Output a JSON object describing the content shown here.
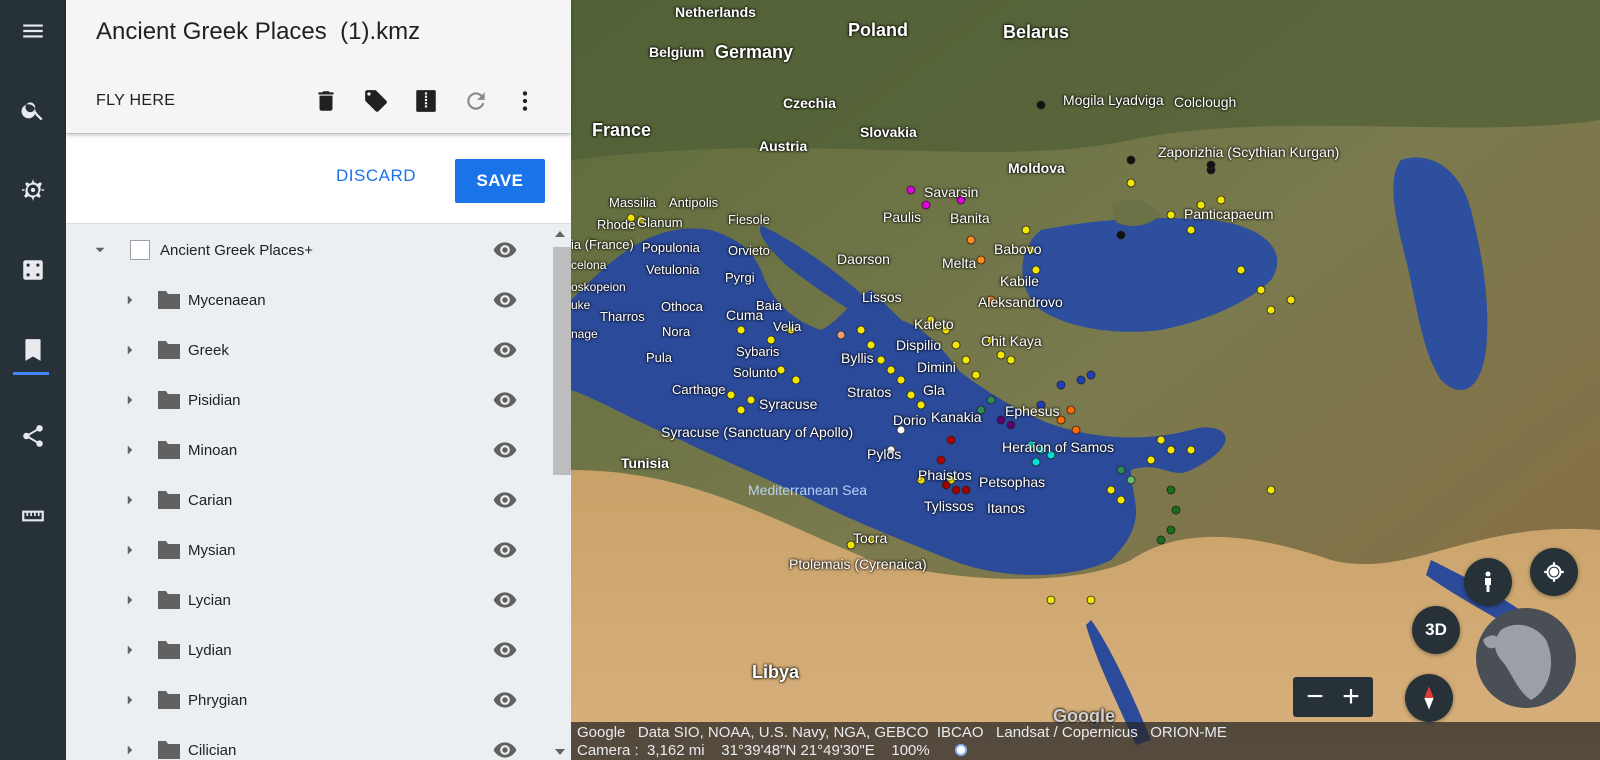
{
  "panel": {
    "title": "Ancient Greek Places  (1).kmz",
    "fly_here": "FLY HERE",
    "discard": "DISCARD",
    "save": "SAVE",
    "root_label": "Ancient Greek Places+",
    "folders": [
      "Mycenaean",
      "Greek",
      "Pisidian",
      "Minoan",
      "Carian",
      "Mysian",
      "Lycian",
      "Lydian",
      "Phrygian",
      "Cilician"
    ]
  },
  "map": {
    "places": {
      "netherlands": "Netherlands",
      "belgium": "Belgium",
      "germany": "Germany",
      "poland": "Poland",
      "belarus": "Belarus",
      "czechia": "Czechia",
      "france": "France",
      "austria": "Austria",
      "slovakia": "Slovakia",
      "moldova": "Moldova",
      "mogila": "Mogila Lyadviga",
      "colclough": "Colclough",
      "zaporizhia": "Zaporizhia (Scythian Kurgan)",
      "panticapaeum": "Panticapaeum",
      "savarsin": "Savarsin",
      "paulis": "Paulis",
      "banita": "Banita",
      "massilia": "Massilia",
      "antipolis": "Antipolis",
      "rhode": "Rhode",
      "glanum": "Glanum",
      "fiesole": "Fiesole",
      "france2": "ia (France)",
      "populonia": "Populonia",
      "orvieto": "Orvieto",
      "celona": "celona",
      "vetulonia": "Vetulonia",
      "pyrgi": "Pyrgi",
      "kopeion": "oskopeion",
      "daorson": "Daorson",
      "babovo": "Babovo",
      "melta": "Melta",
      "kabile": "Kabile",
      "uke": "uke",
      "tharros": "Tharros",
      "othoca": "Othoca",
      "cuma": "Cuma",
      "baia": "Baia",
      "lissos": "Lissos",
      "aleksandrovo": "Aleksandrovo",
      "nage": "nage",
      "nora": "Nora",
      "velia": "Velia",
      "kaleto": "Kaleto",
      "chitkaya": "Chit Kaya",
      "pula": "Pula",
      "sybaris": "Sybaris",
      "byllis": "Byllis",
      "dispilio": "Dispilio",
      "solunto": "Solunto",
      "dimini": "Dimini",
      "carthage": "Carthage",
      "stratos": "Stratos",
      "gla": "Gla",
      "syracuse": "Syracuse",
      "ephesus": "Ephesus",
      "dorio": "Dorio",
      "kanakia": "Kanakia",
      "syracuse_apollo": "Syracuse (Sanctuary of Apollo)",
      "heraion": "Heraion of Samos",
      "tunisia": "Tunisia",
      "pylos": "Pylos",
      "med_sea": "Mediterranean Sea",
      "phaistos": "Phaistos",
      "petsophas": "Petsophas",
      "tylissos": "Tylissos",
      "itanos": "Itanos",
      "tocra": "Tocra",
      "ptolemais": "Ptolemais (Cyrenaica)",
      "libya": "Libya",
      "google": "Google"
    },
    "status_line1": "Google   Data SIO, NOAA, U.S. Navy, NGA, GEBCO  IBCAO   Landsat / Copernicus   ORION-ME",
    "status_line2": "Camera :  3,162 mi    31°39'48\"N 21°49'30\"E    100%",
    "btn_3d": "3D",
    "zoom_out": "−",
    "zoom_in": "+"
  },
  "icons": {
    "rail": [
      "menu-icon",
      "search-icon",
      "voyager-wheel-icon",
      "dice-icon",
      "bookmark-icon",
      "share-icon",
      "ruler-icon"
    ],
    "toolbar": [
      "trash-icon",
      "tag-icon",
      "kmz-file-icon",
      "refresh-icon",
      "more-vert-icon"
    ]
  },
  "colors": {
    "accent": "#1a73e8",
    "rail_bg": "#263238",
    "sea": "#2b4a9a"
  }
}
